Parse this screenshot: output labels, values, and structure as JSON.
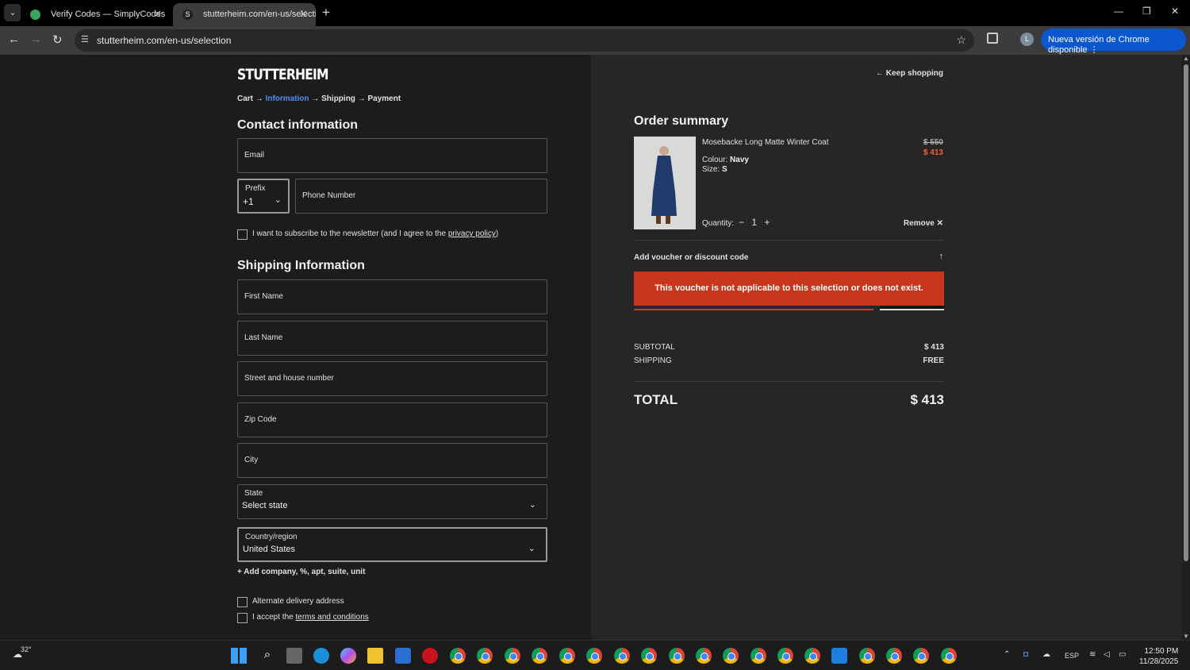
{
  "browser": {
    "tabs": [
      {
        "title": "Verify Codes — SimplyCodes"
      },
      {
        "title": "stutterheim.com/en-us/selectio"
      }
    ],
    "url": "stutterheim.com/en-us/selection",
    "update_button": "Nueva versión de Chrome disponible",
    "profile_initial": "L"
  },
  "header": {
    "logo": "STUTTERHEIM",
    "keep_shopping": "← Keep shopping",
    "breadcrumb": {
      "cart": "Cart",
      "arrow": "→",
      "information": "Information",
      "shipping": "Shipping",
      "payment": "Payment"
    }
  },
  "contact": {
    "title": "Contact information",
    "email_placeholder": "Email",
    "prefix_label": "Prefix",
    "prefix_value": "+1",
    "phone_placeholder": "Phone Number",
    "newsletter_text": "I want to subscribe to the newsletter (and I agree to the",
    "privacy_link": "privacy policy",
    "newsletter_close": ")"
  },
  "shipping": {
    "title": "Shipping Information",
    "first_name": "First Name",
    "last_name": "Last Name",
    "street": "Street and house number",
    "zip": "Zip Code",
    "city": "City",
    "state_label": "State",
    "state_value": "Select state",
    "country_label": "Country/region",
    "country_value": "United States",
    "add_company": "+ Add company, %, apt, suite, unit",
    "alt_delivery": "Alternate delivery address",
    "accept_text": "I accept the",
    "terms_link": "terms and conditions"
  },
  "summary": {
    "title": "Order summary",
    "product_name": "Mosebacke Long Matte Winter Coat",
    "colour_label": "Colour:",
    "colour_value": "Navy",
    "size_label": "Size:",
    "size_value": "S",
    "old_price": "$ 550",
    "new_price": "$ 413",
    "quantity_label": "Quantity:",
    "quantity_minus": "−",
    "quantity_value": "1",
    "quantity_plus": "+",
    "remove": "Remove ✕",
    "voucher_label": "Add voucher or discount code",
    "voucher_toggle": "↑",
    "error": "This voucher is not applicable to this selection or does not exist.",
    "subtotal_label": "SUBTOTAL",
    "subtotal_value": "$ 413",
    "shipping_label": "SHIPPING",
    "shipping_value": "FREE",
    "total_label": "TOTAL",
    "total_value": "$ 413"
  },
  "taskbar": {
    "weather": "32°",
    "language": "ESP",
    "time": "12:50 PM",
    "date": "11/28/2025"
  },
  "colors": {
    "accent_link": "#4e8cf5",
    "sale_price": "#ff5d33",
    "error_bg": "#c7361a",
    "chrome_update": "#0b57d0"
  }
}
